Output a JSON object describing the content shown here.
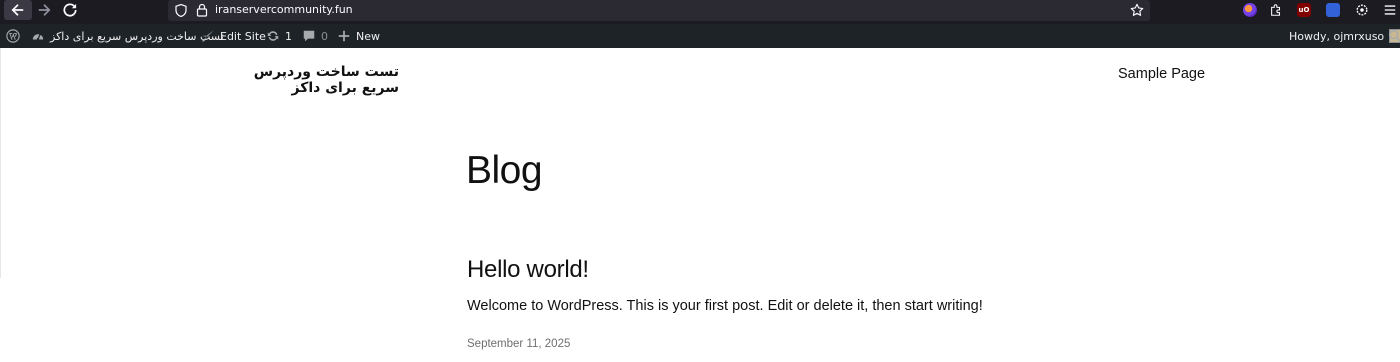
{
  "browser": {
    "url": "iranservercommunity.fun"
  },
  "admin_bar": {
    "site_name": "تست ساخت وردپرس سریع برای داکز",
    "edit_site": "Edit Site",
    "updates_count": "1",
    "comments_count": "0",
    "new_label": "New",
    "howdy": "Howdy, ojmrxuso"
  },
  "site": {
    "title": "تست ساخت وردپرس سریع برای داکز",
    "nav": [
      "Sample Page"
    ]
  },
  "main": {
    "heading": "Blog",
    "posts": [
      {
        "title": "Hello world!",
        "excerpt": "Welcome to WordPress. This is your first post. Edit or delete it, then start writing!",
        "date": "September 11, 2025"
      }
    ]
  },
  "colors": {
    "browser_chrome": "#1c1b22",
    "url_bar": "#2b2a33",
    "admin_bar": "#1d2327",
    "text": "#111111"
  }
}
